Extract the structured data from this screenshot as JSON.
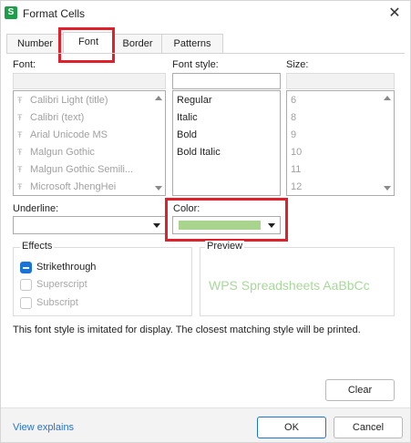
{
  "window": {
    "title": "Format Cells",
    "app_icon_letter": "S",
    "close_glyph": "✕"
  },
  "tabs": [
    {
      "label": "Number",
      "active": false
    },
    {
      "label": "Font",
      "active": true
    },
    {
      "label": "Border",
      "active": false
    },
    {
      "label": "Patterns",
      "active": false
    }
  ],
  "font": {
    "label": "Font:",
    "items": [
      "Calibri Light (title)",
      "Calibri (text)",
      "Arial Unicode MS",
      "Malgun Gothic",
      "Malgun Gothic Semili...",
      "Microsoft JhengHei"
    ]
  },
  "font_style": {
    "label": "Font style:",
    "items": [
      "Regular",
      "Italic",
      "Bold",
      "Bold Italic"
    ]
  },
  "size": {
    "label": "Size:",
    "items": [
      "6",
      "8",
      "9",
      "10",
      "11",
      "12"
    ]
  },
  "underline": {
    "label": "Underline:",
    "value": ""
  },
  "color": {
    "label": "Color:",
    "swatch": "#a8d48e"
  },
  "effects": {
    "label": "Effects",
    "strikethrough": {
      "label": "Strikethrough",
      "checked": true
    },
    "superscript": {
      "label": "Superscript",
      "checked": false
    },
    "subscript": {
      "label": "Subscript",
      "checked": false
    }
  },
  "preview": {
    "label": "Preview",
    "text": "WPS Spreadsheets  AaBbCc"
  },
  "note": "This font style is imitated for display. The closest matching style will be printed.",
  "buttons": {
    "clear": "Clear",
    "ok": "OK",
    "cancel": "Cancel"
  },
  "footer_link": "View explains",
  "colors": {
    "highlight": "#e0202a",
    "accent": "#1a73d8",
    "link": "#2b73c4"
  }
}
